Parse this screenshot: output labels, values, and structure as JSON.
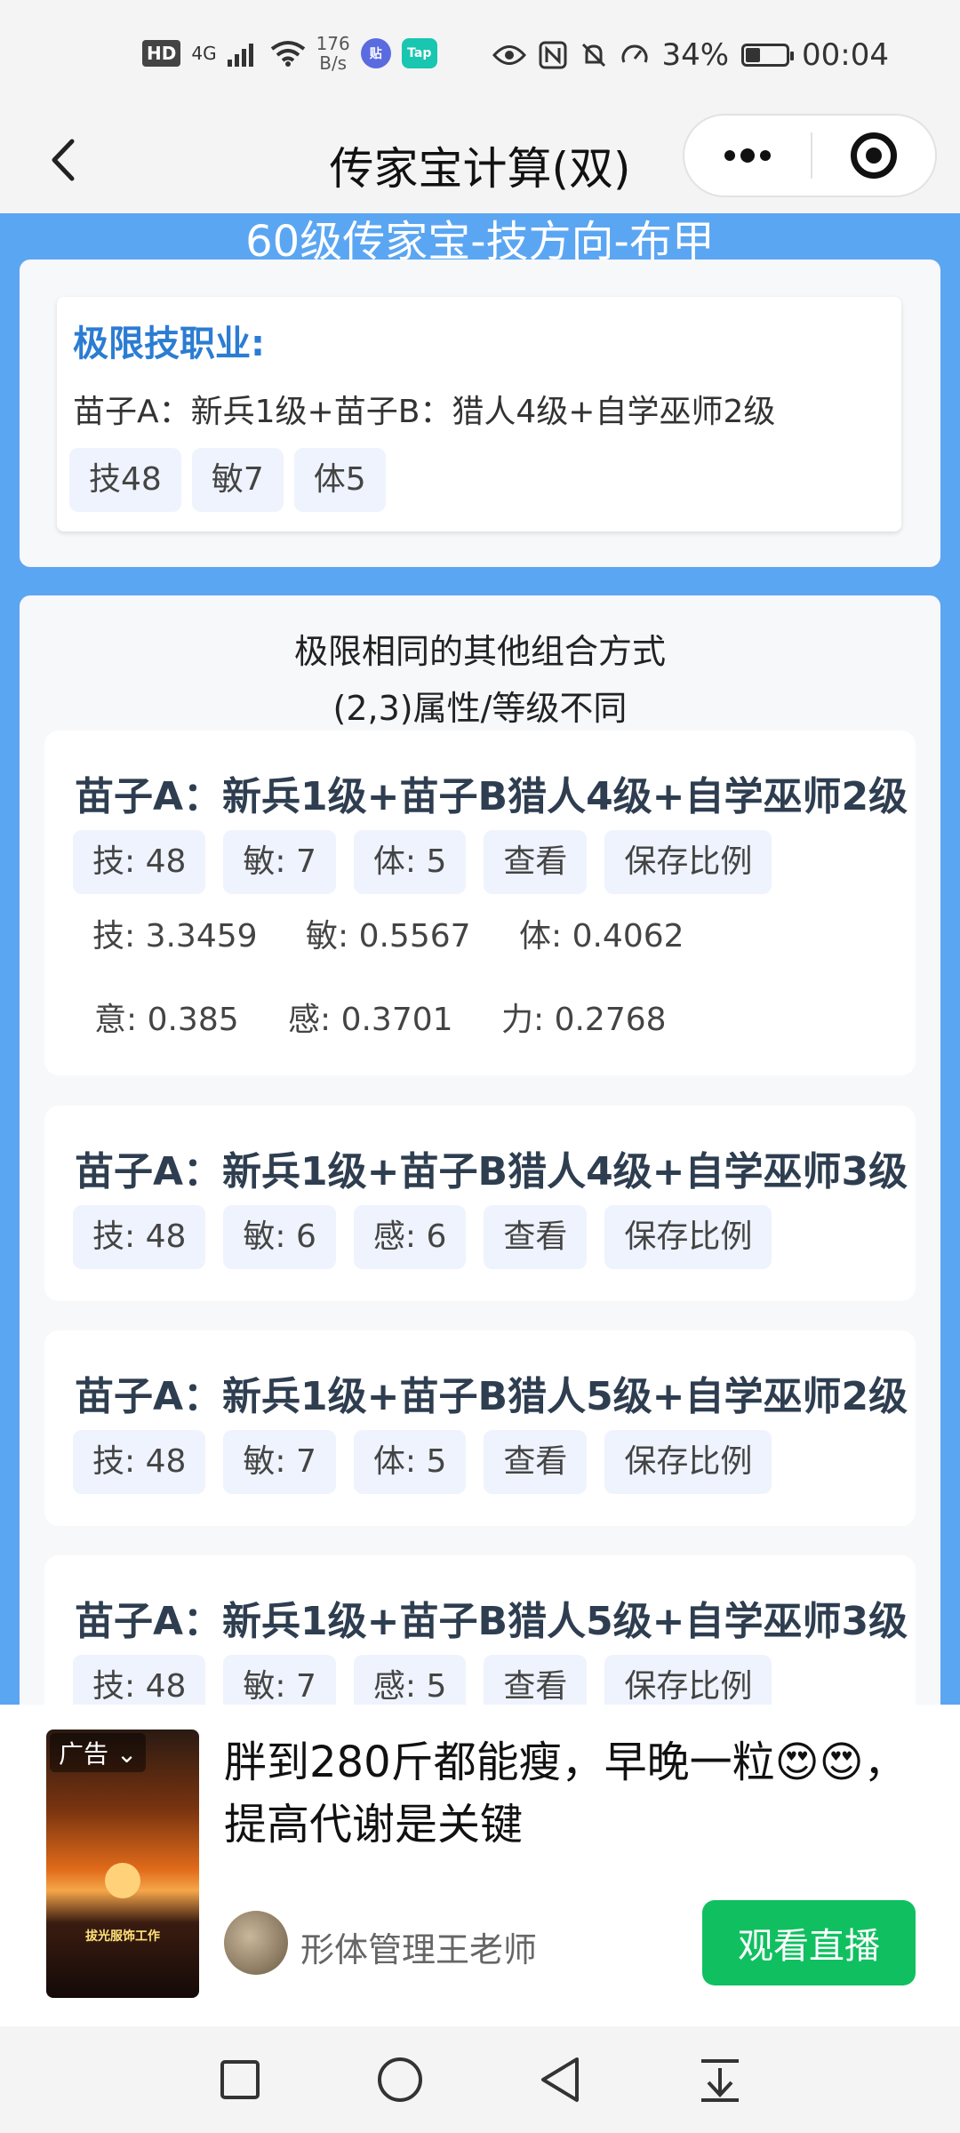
{
  "status": {
    "hd": "HD",
    "network": "4G",
    "speed_value": "176",
    "speed_unit": "B/s",
    "battery": "34%",
    "time": "00:04",
    "app1": "贴",
    "app2": "Tap"
  },
  "nav": {
    "title": "传家宝计算(双)"
  },
  "header": {
    "blue_title": "60级传家宝-技方向-布甲"
  },
  "limit": {
    "heading": "极限技职业:",
    "line": "苗子A：新兵1级+苗子B：猎人4级+自学巫师2级",
    "chips": [
      "技48",
      "敏7",
      "体5"
    ]
  },
  "others": {
    "title1": "极限相同的其他组合方式",
    "title2": "(2,3)属性/等级不同",
    "combos": [
      {
        "title": "苗子A：新兵1级+苗子B猎人4级+自学巫师2级",
        "chips": [
          "技: 48",
          "敏: 7",
          "体: 5",
          "查看",
          "保存比例"
        ],
        "ratios1": [
          "技: 3.3459",
          "敏: 0.5567",
          "体: 0.4062"
        ],
        "ratios2": [
          "意: 0.385",
          "感: 0.3701",
          "力: 0.2768"
        ]
      },
      {
        "title": "苗子A：新兵1级+苗子B猎人4级+自学巫师3级",
        "chips": [
          "技: 48",
          "敏: 6",
          "感: 6",
          "查看",
          "保存比例"
        ]
      },
      {
        "title": "苗子A：新兵1级+苗子B猎人5级+自学巫师2级",
        "chips": [
          "技: 48",
          "敏: 7",
          "体: 5",
          "查看",
          "保存比例"
        ]
      },
      {
        "title": "苗子A：新兵1级+苗子B猎人5级+自学巫师3级",
        "chips": [
          "技: 48",
          "敏: 7",
          "感: 5",
          "查看",
          "保存比例"
        ]
      }
    ]
  },
  "ad": {
    "tag": "广告 ⌄",
    "caption": "拔光服饰工作",
    "text": "胖到280斤都能瘦，早晚一粒😍😍，提高代谢是关键",
    "author": "形体管理王老师",
    "button": "观看直播"
  },
  "colors": {
    "accent_blue": "#5ba6f2",
    "heading_blue": "#2b7cd3",
    "chip_bg": "#eef3fd",
    "ad_button": "#10c060"
  }
}
